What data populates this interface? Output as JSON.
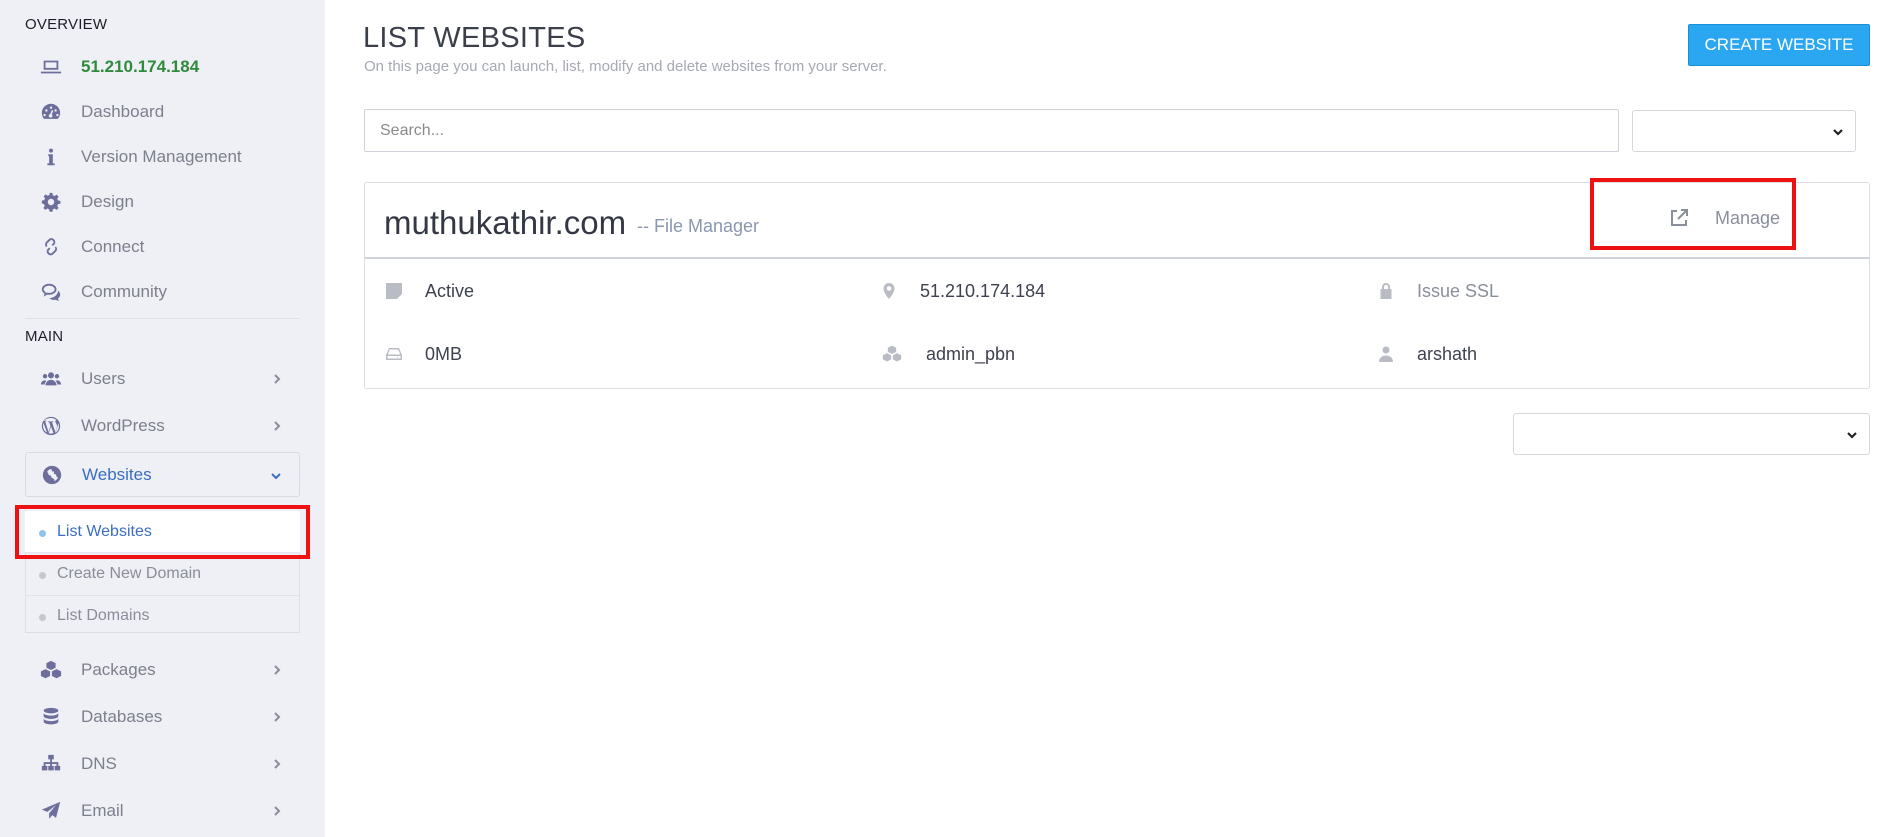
{
  "sidebar": {
    "overview_heading": "OVERVIEW",
    "main_heading": "MAIN",
    "overview_items": [
      {
        "label": "51.210.174.184",
        "icon": "laptop-icon"
      },
      {
        "label": "Dashboard",
        "icon": "dashboard-icon"
      },
      {
        "label": "Version Management",
        "icon": "info-icon"
      },
      {
        "label": "Design",
        "icon": "gear-icon"
      },
      {
        "label": "Connect",
        "icon": "link-icon"
      },
      {
        "label": "Community",
        "icon": "comments-icon"
      }
    ],
    "main_items": [
      {
        "label": "Users",
        "icon": "users-icon"
      },
      {
        "label": "WordPress",
        "icon": "wordpress-icon"
      },
      {
        "label": "Websites",
        "icon": "globe-icon"
      },
      {
        "label": "Packages",
        "icon": "cubes-icon"
      },
      {
        "label": "Databases",
        "icon": "database-icon"
      },
      {
        "label": "DNS",
        "icon": "sitemap-icon"
      },
      {
        "label": "Email",
        "icon": "paper-plane-icon"
      }
    ],
    "websites_sub": [
      {
        "label": "List Websites"
      },
      {
        "label": "Create New Domain"
      },
      {
        "label": "List Domains"
      }
    ]
  },
  "main": {
    "title": "LIST WEBSITES",
    "subtitle": "On this page you can launch, list, modify and delete websites from your server.",
    "create_button": "CREATE WEBSITE",
    "search_placeholder": "Search...",
    "site": {
      "domain": "muthukathir.com",
      "file_manager": "-- File Manager",
      "manage": "Manage",
      "status": "Active",
      "ip": "51.210.174.184",
      "ssl": "Issue SSL",
      "disk": "0MB",
      "package": "admin_pbn",
      "owner": "arshath"
    }
  },
  "colors": {
    "accent": "#2ba7f1",
    "active_link": "#3b6ec0",
    "ip_green": "#2f8a3c",
    "highlight_red": "#ee1111",
    "sidebar_bg": "#eef0f6"
  }
}
